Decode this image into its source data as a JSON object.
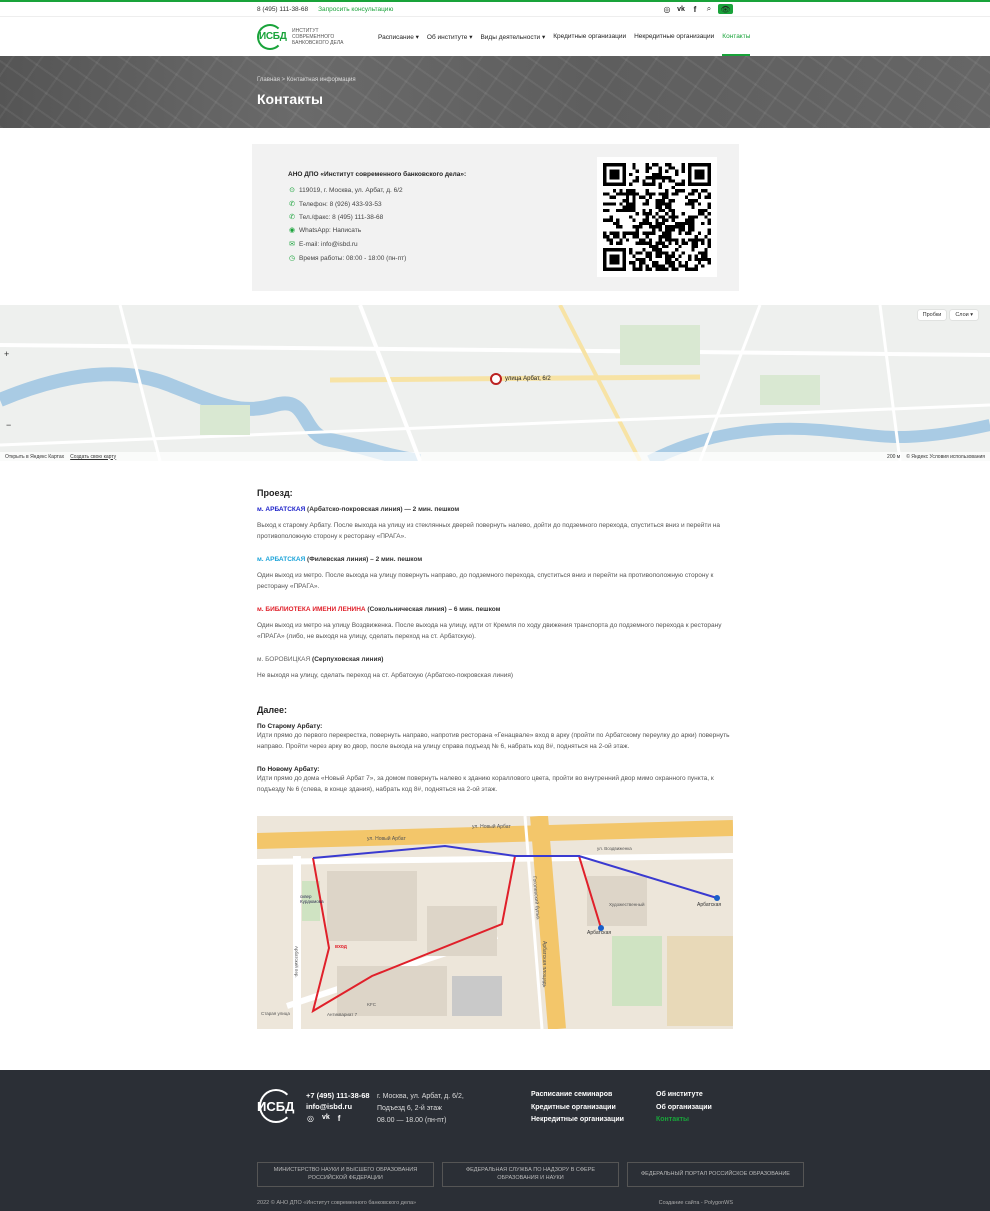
{
  "topbar": {
    "phone": "8 (495) 111-38-68",
    "consult": "Запросить консультацию",
    "icons": [
      "instagram-icon",
      "vk-icon",
      "facebook-icon",
      "search-icon",
      "eye-icon"
    ]
  },
  "header": {
    "logo_text": "ИСБД",
    "logo_sub": "ИНСТИТУТ СОВРЕМЕННОГО БАНКОВСКОГО ДЕЛА",
    "nav": [
      {
        "label": "Расписание ▾"
      },
      {
        "label": "Об институте ▾"
      },
      {
        "label": "Виды деятельности ▾"
      },
      {
        "label": "Кредитные организации"
      },
      {
        "label": "Некредитные организации"
      },
      {
        "label": "Контакты"
      }
    ]
  },
  "hero": {
    "breadcrumb": "Главная  >  Контактная информация",
    "title": "Контакты"
  },
  "contact": {
    "org": "АНО ДПО «Институт современного банковского дела»:",
    "rows": [
      {
        "icon": "location-icon",
        "glyph": "⊙",
        "text": "119019, г. Москва, ул. Арбат, д. 6/2"
      },
      {
        "icon": "phone-icon",
        "glyph": "✆",
        "text": "Телефон: 8 (926) 433-93-53"
      },
      {
        "icon": "phone-icon",
        "glyph": "✆",
        "text": "Тел./факс: 8 (495) 111-38-68"
      },
      {
        "icon": "whatsapp-icon",
        "glyph": "◉",
        "text": "WhatsApp: Написать"
      },
      {
        "icon": "email-icon",
        "glyph": "✉",
        "text": "E-mail: info@isbd.ru"
      },
      {
        "icon": "clock-icon",
        "glyph": "◷",
        "text": "Время работы: 08:00 - 18:00 (пн-пт)"
      }
    ]
  },
  "map1": {
    "traffic": "Пробки",
    "layers": "Слои ▾",
    "pin_label": "улица Арбат, 6/2",
    "open_yandex": "Открыть в Яндекс Картах",
    "create_map": "Создать свою карту",
    "scale": "200 м",
    "terms": "© Яндекс  Условия использования",
    "zoom_in": "+",
    "zoom_out": "−"
  },
  "travel": {
    "title": "Проезд:",
    "items": [
      {
        "station": "м. АРБАТСКАЯ",
        "color": "#1a1fc9",
        "line": " (Арбатско-покровская линия) — 2 мин. пешком",
        "text": "Выход к старому Арбату. После выхода на улицу из стеклянных дверей повернуть налево, дойти до подземного перехода, спуститься вниз и перейти на противоположную сторону к ресторану «ПРАГА»."
      },
      {
        "station": "м. АРБАТСКАЯ",
        "color": "#1aa3d9",
        "line": " (Филевская линия) – 2 мин. пешком",
        "text": "Один выход из метро. После выхода на улицу повернуть направо, до подземного перехода, спуститься вниз и перейти на противоположную сторону к ресторану «ПРАГА»."
      },
      {
        "station": "м. БИБЛИОТЕКА ИМЕНИ ЛЕНИНА",
        "color": "#e0202a",
        "line": " (Сокольническая линия) – 6 мин. пешком",
        "text": "Один выход из метро на улицу Воздвиженка. После выхода на улицу, идти от Кремля по ходу движения транспорта до подземного перехода к ресторану «ПРАГА» (либо, не выходя на улицу, сделать переход на ст. Арбатскую)."
      },
      {
        "station": "м. БОРОВИЦКАЯ",
        "color": "#666666",
        "line": " (Серпуховская линия)",
        "text": "Не выходя на улицу, сделать переход на ст. Арбатскую (Арбатско-покровская линия)"
      }
    ]
  },
  "further": {
    "title": "Далее:",
    "old_arbat_h": "По Старому Арбату:",
    "old_arbat": "Идти прямо до первого перекрестка, повернуть направо, напротив ресторана «Генацвале» вход в арку (пройти по Арбатскому переулку до арки) повернуть направо. Пройти через арку во двор, после выхода на улицу справа подъезд № 6, набрать код 8#, подняться на 2-ой этаж.",
    "new_arbat_h": "По Новому Арбату:",
    "new_arbat": "Идти прямо до дома «Новый Арбат 7», за домом повернуть налево к зданию кораллового цвета, пройти во внутренний двор мимо охранного пункта, к подъезду № 6 (слева, в конце здания), набрать код 8#, подняться на 2-ой этаж."
  },
  "map2": {
    "street_top": "ул. Новый Арбат",
    "street_top2": "ул. Новый Арбат",
    "vozdv": "ул. Воздвиженка",
    "gogol": "Гоголевский бульв.",
    "arbat_sq": "Арбатская площадь",
    "arbatskaya1": "Арбатская",
    "arbatskaya2": "Арбатская",
    "vhod": "вход",
    "skver": "сквер Курдюмова",
    "arbat_lane": "Арбатский пер.",
    "starye": "Старая улица",
    "antikvariat": "Антиквариат 7",
    "kfc": "KFC",
    "hud": "Художественный"
  },
  "footer": {
    "logo_text": "ИСБД",
    "phone": "+7 (495) 111-38-68",
    "email": "info@isbd.ru",
    "address": [
      "г. Москва, ул. Арбат, д. 6/2,",
      "Подъезд 6, 2-й этаж",
      "08.00 — 18.00 (пн-пт)"
    ],
    "nav1": [
      "Расписание семинаров",
      "Кредитные организации",
      "Некредитные организации"
    ],
    "nav2": [
      "Об институте",
      "Об организации",
      "Контакты"
    ],
    "boxes": [
      "МИНИСТЕРСТВО НАУКИ И ВЫСШЕГО ОБРАЗОВАНИЯ РОССИЙСКОЙ ФЕДЕРАЦИИ",
      "ФЕДЕРАЛЬНАЯ СЛУЖБА ПО НАДЗОРУ В СФЕРЕ ОБРАЗОВАНИЯ И НАУКИ",
      "ФЕДЕРАЛЬНЫЙ ПОРТАЛ РОССИЙСКОЕ ОБРАЗОВАНИЕ"
    ],
    "copyright": "2022 © АНО ДПО «Институт современного банковского дела»",
    "developer": "Создание сайта - PolygonWS"
  },
  "colors": {
    "accent": "#19a33a",
    "footer_bg": "#2b2f36",
    "route_red": "#e0202a",
    "route_blue": "#3a3ad0"
  }
}
